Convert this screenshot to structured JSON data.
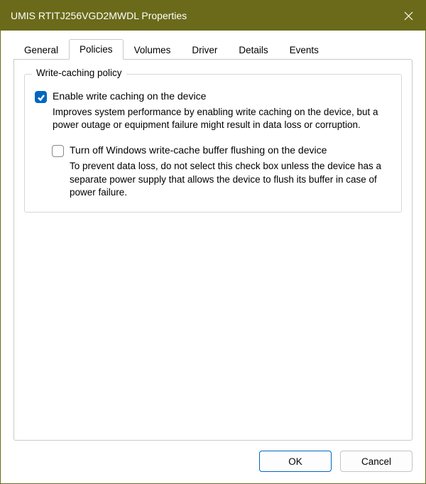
{
  "window": {
    "title": "UMIS RTITJ256VGD2MWDL Properties"
  },
  "tabs": {
    "items": [
      {
        "label": "General"
      },
      {
        "label": "Policies"
      },
      {
        "label": "Volumes"
      },
      {
        "label": "Driver"
      },
      {
        "label": "Details"
      },
      {
        "label": "Events"
      }
    ],
    "active_index": 1
  },
  "group": {
    "legend": "Write-caching policy",
    "option1": {
      "checked": true,
      "label": "Enable write caching on the device",
      "desc": "Improves system performance by enabling write caching on the device, but a power outage or equipment failure might result in data loss or corruption."
    },
    "option2": {
      "checked": false,
      "label": "Turn off Windows write-cache buffer flushing on the device",
      "desc": "To prevent data loss, do not select this check box unless the device has a separate power supply that allows the device to flush its buffer in case of power failure."
    }
  },
  "buttons": {
    "ok": "OK",
    "cancel": "Cancel"
  }
}
